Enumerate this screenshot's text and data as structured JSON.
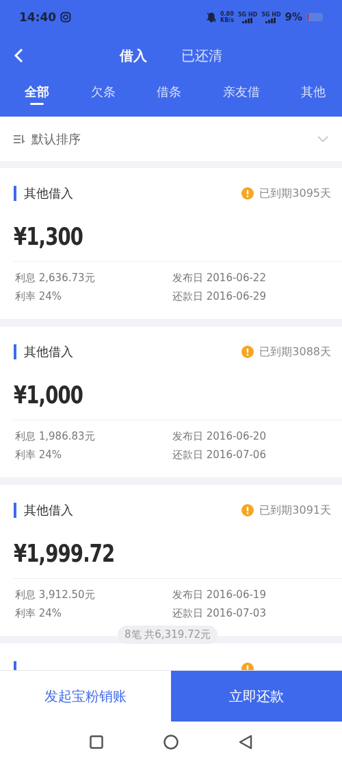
{
  "status_bar": {
    "time": "14:40",
    "net_speed": "0.80",
    "net_unit": "KB/s",
    "signal_1": "5G HD",
    "signal_2": "5G HD",
    "battery": "9%"
  },
  "header": {
    "tabs": [
      {
        "label": "借入",
        "selected": true
      },
      {
        "label": "已还清",
        "selected": false
      }
    ]
  },
  "categories": [
    {
      "label": "全部",
      "selected": true
    },
    {
      "label": "欠条",
      "selected": false
    },
    {
      "label": "借条",
      "selected": false
    },
    {
      "label": "亲友借",
      "selected": false
    },
    {
      "label": "其他",
      "selected": false
    }
  ],
  "sort": {
    "label": "默认排序"
  },
  "loans": [
    {
      "type": "其他借入",
      "overdue": "已到期3095天",
      "amount": "¥1,300",
      "interest": "利息 2,636.73元",
      "publish_date": "发布日 2016-06-22",
      "rate": "利率 24%",
      "due_date": "还款日 2016-06-29"
    },
    {
      "type": "其他借入",
      "overdue": "已到期3088天",
      "amount": "¥1,000",
      "interest": "利息 1,986.83元",
      "publish_date": "发布日 2016-06-20",
      "rate": "利率 24%",
      "due_date": "还款日 2016-07-06"
    },
    {
      "type": "其他借入",
      "overdue": "已到期3091天",
      "amount": "¥1,999.72",
      "interest": "利息 3,912.50元",
      "publish_date": "发布日 2016-06-19",
      "rate": "利率 24%",
      "due_date": "还款日 2016-07-03"
    },
    {
      "partial": true
    }
  ],
  "summary_toast": "8笔 共6,319.72元",
  "actions": {
    "secondary": "发起宝粉销账",
    "primary": "立即还款"
  }
}
